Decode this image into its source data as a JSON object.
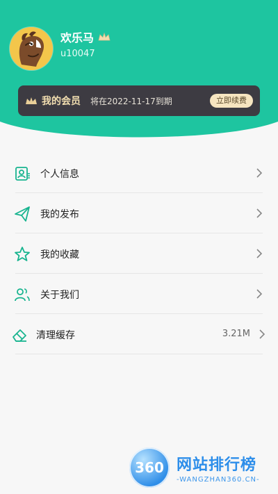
{
  "profile": {
    "name": "欢乐马",
    "uid": "u10047"
  },
  "vip": {
    "title": "我的会员",
    "expire_text": "将在2022-11-17到期",
    "renew_label": "立即续费"
  },
  "menu": {
    "items": [
      {
        "label": "个人信息",
        "icon": "profile-icon"
      },
      {
        "label": "我的发布",
        "icon": "send-icon"
      },
      {
        "label": "我的收藏",
        "icon": "star-icon"
      },
      {
        "label": "关于我们",
        "icon": "people-icon"
      }
    ],
    "clear": {
      "label": "清理缓存",
      "value": "3.21M",
      "icon": "eraser-icon"
    }
  },
  "watermark": {
    "logo": "360",
    "title": "网站排行榜",
    "subtitle": "-WANGZHAN360.CN-"
  },
  "colors": {
    "header": "#1ec5a0",
    "accent": "#18b48f",
    "vip_bg": "#3d3b42"
  }
}
